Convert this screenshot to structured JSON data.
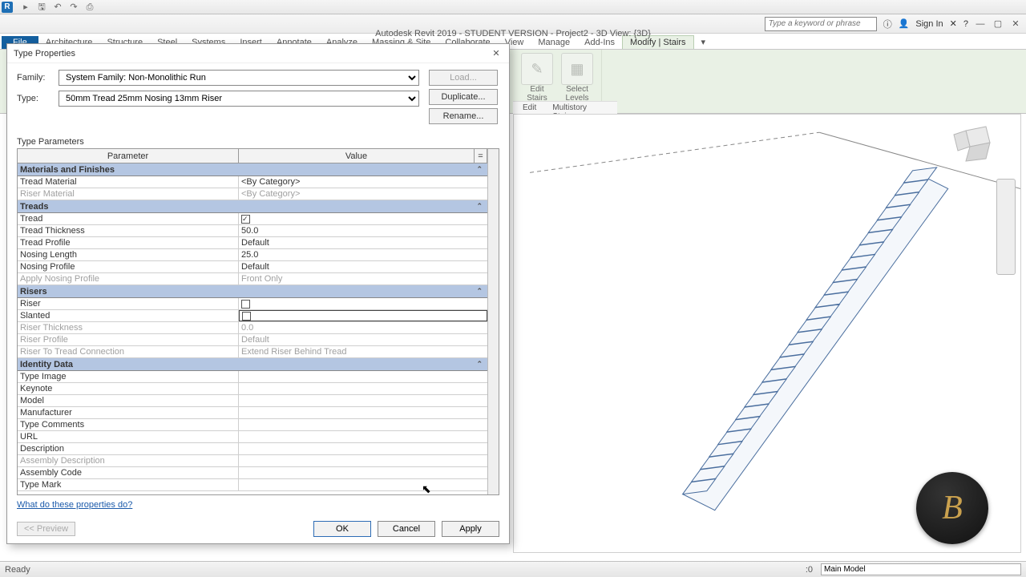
{
  "app": {
    "title": "Autodesk Revit 2019 - STUDENT VERSION - Project2 - 3D View: {3D}",
    "search_placeholder": "Type a keyword or phrase",
    "signin": "Sign In"
  },
  "ribbon_tabs": [
    "Architecture",
    "Structure",
    "Steel",
    "Systems",
    "Insert",
    "Annotate",
    "Analyze",
    "Massing & Site",
    "Collaborate",
    "View",
    "Manage",
    "Add-Ins",
    "Modify | Stairs"
  ],
  "file_tab": "File",
  "ribbon": {
    "edit_stairs": "Edit\nStairs",
    "select_levels": "Select\nLevels",
    "edit_group": "Edit",
    "multistory_group": "Multistory Stairs"
  },
  "dialog": {
    "title": "Type Properties",
    "family_label": "Family:",
    "family_value": "System Family: Non-Monolithic Run",
    "type_label": "Type:",
    "type_value": "50mm Tread 25mm Nosing 13mm Riser",
    "load": "Load...",
    "duplicate": "Duplicate...",
    "rename": "Rename...",
    "params_heading": "Type Parameters",
    "col_param": "Parameter",
    "col_value": "Value",
    "help": "What do these properties do?",
    "preview": "<< Preview",
    "ok": "OK",
    "cancel": "Cancel",
    "apply": "Apply"
  },
  "groups": [
    {
      "name": "Materials and Finishes",
      "rows": [
        {
          "p": "Tread Material",
          "v": "<By Category>",
          "d": false
        },
        {
          "p": "Riser Material",
          "v": "<By Category>",
          "d": true
        }
      ]
    },
    {
      "name": "Treads",
      "rows": [
        {
          "p": "Tread",
          "v": "[x]",
          "d": false
        },
        {
          "p": "Tread Thickness",
          "v": "50.0",
          "d": false
        },
        {
          "p": "Tread Profile",
          "v": "Default",
          "d": false
        },
        {
          "p": "Nosing Length",
          "v": "25.0",
          "d": false
        },
        {
          "p": "Nosing Profile",
          "v": "Default",
          "d": false
        },
        {
          "p": "Apply Nosing Profile",
          "v": "Front Only",
          "d": true
        }
      ]
    },
    {
      "name": "Risers",
      "rows": [
        {
          "p": "Riser",
          "v": "[ ]",
          "d": false
        },
        {
          "p": "Slanted",
          "v": "[ ]",
          "d": false,
          "sel": true
        },
        {
          "p": "Riser Thickness",
          "v": "0.0",
          "d": true
        },
        {
          "p": "Riser Profile",
          "v": "Default",
          "d": true
        },
        {
          "p": "Riser To Tread Connection",
          "v": "Extend Riser Behind Tread",
          "d": true
        }
      ]
    },
    {
      "name": "Identity Data",
      "rows": [
        {
          "p": "Type Image",
          "v": "",
          "d": false
        },
        {
          "p": "Keynote",
          "v": "",
          "d": false
        },
        {
          "p": "Model",
          "v": "",
          "d": false
        },
        {
          "p": "Manufacturer",
          "v": "",
          "d": false
        },
        {
          "p": "Type Comments",
          "v": "",
          "d": false
        },
        {
          "p": "URL",
          "v": "",
          "d": false
        },
        {
          "p": "Description",
          "v": "",
          "d": false
        },
        {
          "p": "Assembly Description",
          "v": "",
          "d": true
        },
        {
          "p": "Assembly Code",
          "v": "",
          "d": false
        },
        {
          "p": "Type Mark",
          "v": "",
          "d": false
        }
      ]
    }
  ],
  "status": {
    "ready": "Ready",
    ":0": ":0",
    "main_model": "Main Model"
  }
}
